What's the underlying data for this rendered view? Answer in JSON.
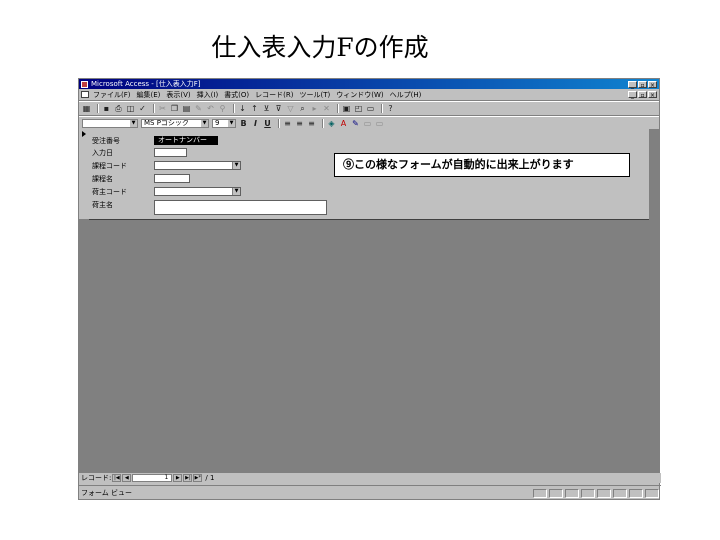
{
  "slide": {
    "title": "仕入表入力Fの作成"
  },
  "window": {
    "title": "Microsoft Access - [仕入表入力F]",
    "btn_min": "_",
    "btn_restore": "▫",
    "btn_close": "×"
  },
  "menu": {
    "items": [
      "ファイル(F)",
      "編集(E)",
      "表示(V)",
      "挿入(I)",
      "書式(O)",
      "レコード(R)",
      "ツール(T)",
      "ウィンドウ(W)",
      "ヘルプ(H)"
    ]
  },
  "format_bar": {
    "font_name": "MS Pゴシック",
    "font_size": "9",
    "bold": "B",
    "italic": "I",
    "underline": "U"
  },
  "form": {
    "fields": [
      {
        "label": "受注番号",
        "value": "オートナンバー"
      },
      {
        "label": "入力日",
        "value": ""
      },
      {
        "label": "課程コード",
        "value": ""
      },
      {
        "label": "課程名",
        "value": ""
      },
      {
        "label": "荷主コード",
        "value": ""
      },
      {
        "label": "荷主名",
        "value": ""
      }
    ]
  },
  "callout": {
    "text": "⑨この様なフォームが自動的に出来上がります"
  },
  "navigation": {
    "label": "レコード:",
    "first": "|◀",
    "prev": "◀",
    "current": "1",
    "next": "▶",
    "last": "▶|",
    "new": "▶*",
    "total": "/ 1"
  },
  "status": {
    "text": "フォーム ビュー"
  }
}
